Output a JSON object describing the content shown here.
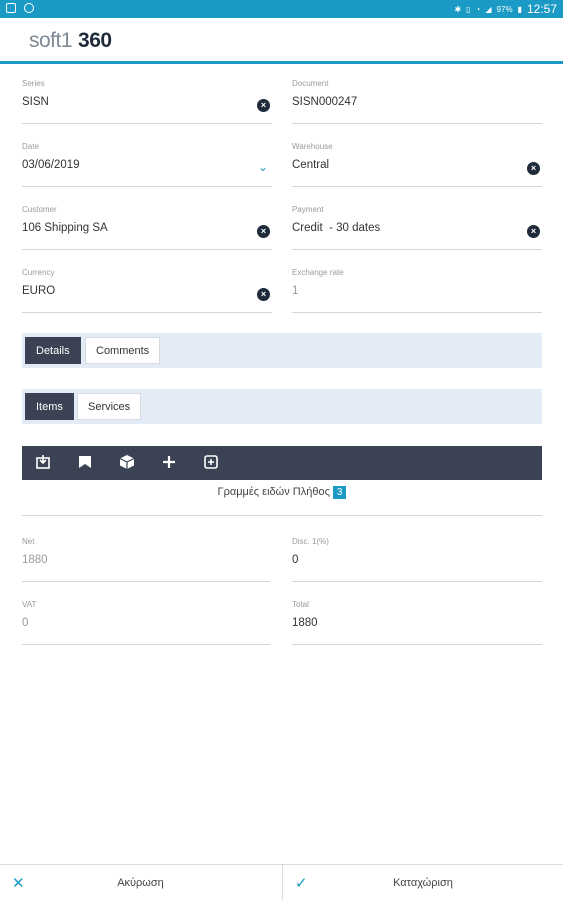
{
  "statusbar": {
    "battery": "97%",
    "time": "12:57"
  },
  "app": {
    "logo_soft": "soft1",
    "logo_num": "360"
  },
  "form": {
    "series": {
      "label": "Series",
      "value": "SISN"
    },
    "document": {
      "label": "Document",
      "value": "SISN000247"
    },
    "date": {
      "label": "Date",
      "value": "03/06/2019"
    },
    "warehouse": {
      "label": "Warehouse",
      "value": "Central"
    },
    "customer": {
      "label": "Customer",
      "value": "106 Shipping SA"
    },
    "payment": {
      "label": "Payment",
      "value": "Credit  - 30 dates"
    },
    "currency": {
      "label": "Currency",
      "value": "EURO"
    },
    "exchange_rate": {
      "label": "Exchange rate",
      "value": "1"
    }
  },
  "tabs_main": [
    {
      "label": "Details",
      "active": true
    },
    {
      "label": "Comments",
      "active": false
    }
  ],
  "tabs_sub": [
    {
      "label": "Items",
      "active": true
    },
    {
      "label": "Services",
      "active": false
    }
  ],
  "toolbar": {
    "icons": [
      "import-icon",
      "bookmark-icon",
      "box-icon",
      "plus-icon",
      "add-copy-icon"
    ]
  },
  "lines_info": {
    "text": "Γραμμές ειδών Πλήθος",
    "count": "3"
  },
  "totals": {
    "net": {
      "label": "Net",
      "value": "1880"
    },
    "disc": {
      "label": "Disc. 1(%)",
      "value": "0"
    },
    "vat": {
      "label": "VAT",
      "value": "0"
    },
    "total": {
      "label": "Total",
      "value": "1880"
    }
  },
  "bottom": {
    "cancel_label": "Ακύρωση",
    "save_label": "Καταχώριση"
  },
  "colors": {
    "accent": "#1a9ac4",
    "dark": "#3a4253"
  }
}
